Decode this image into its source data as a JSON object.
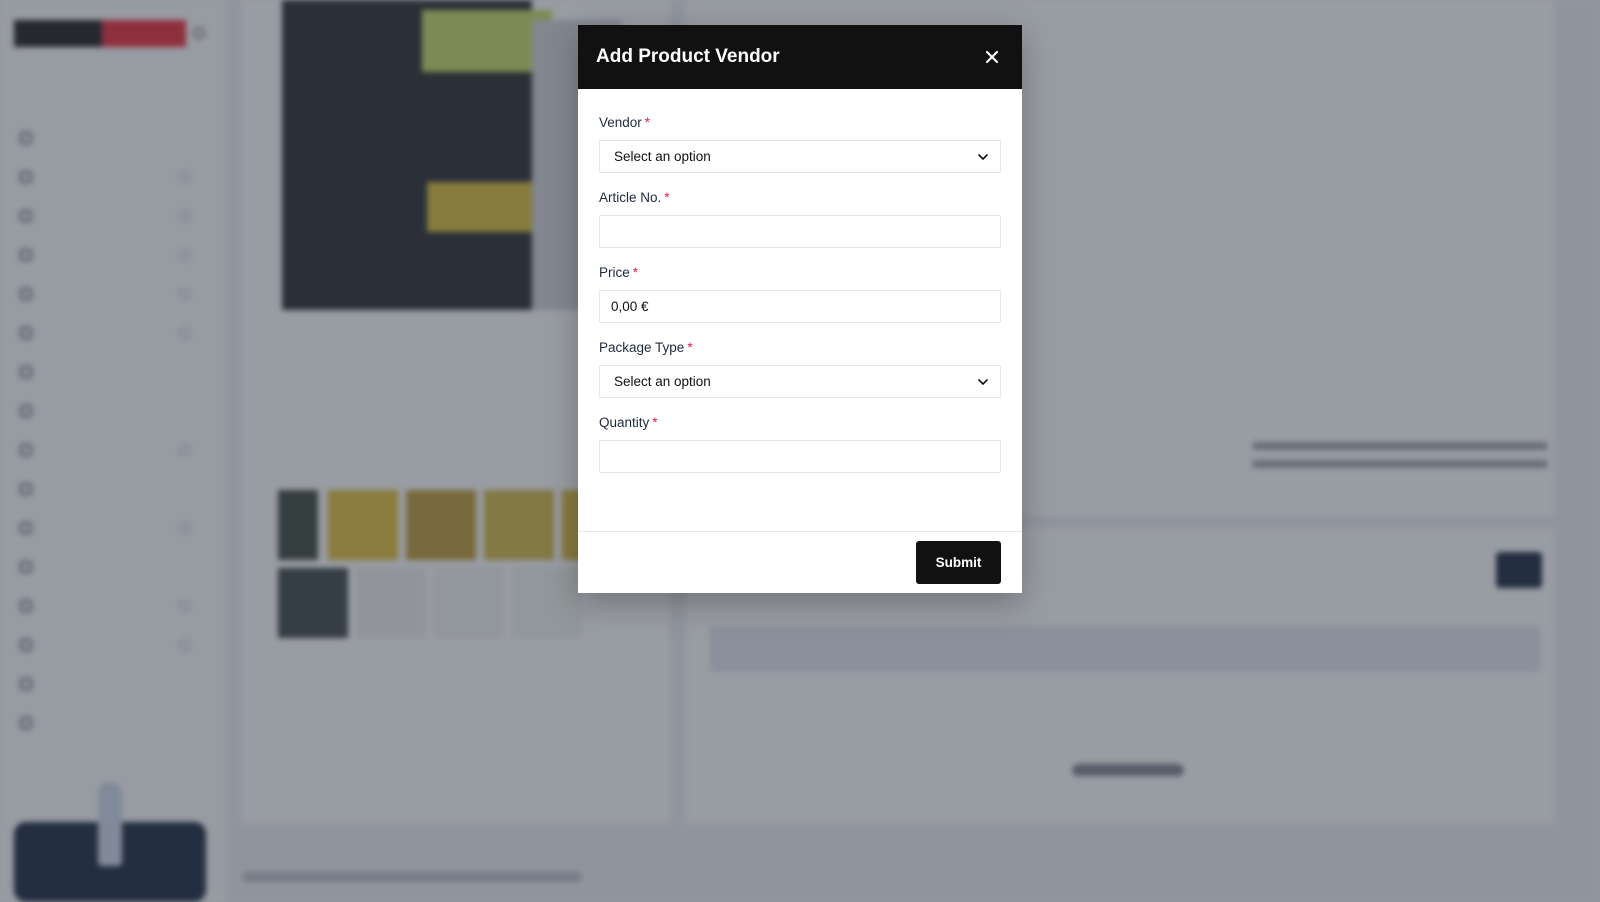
{
  "modal": {
    "title": "Add Product Vendor",
    "fields": [
      {
        "label": "Vendor",
        "required_mark": "*",
        "type": "select",
        "value": "Select an option"
      },
      {
        "label": "Article No.",
        "required_mark": "*",
        "type": "text",
        "value": ""
      },
      {
        "label": "Price",
        "required_mark": "*",
        "type": "text",
        "value": "0,00 €"
      },
      {
        "label": "Package Type",
        "required_mark": "*",
        "type": "select",
        "value": "Select an option"
      },
      {
        "label": "Quantity",
        "required_mark": "*",
        "type": "text",
        "value": ""
      }
    ],
    "submit_label": "Submit"
  },
  "icons": {
    "close": "close-icon",
    "select_caret": "chevron-down-icon"
  },
  "colors": {
    "modal_header": "#111111",
    "required": "#e11d48",
    "submit": "#111111",
    "overlay": "rgba(60,66,78,0.5)"
  }
}
